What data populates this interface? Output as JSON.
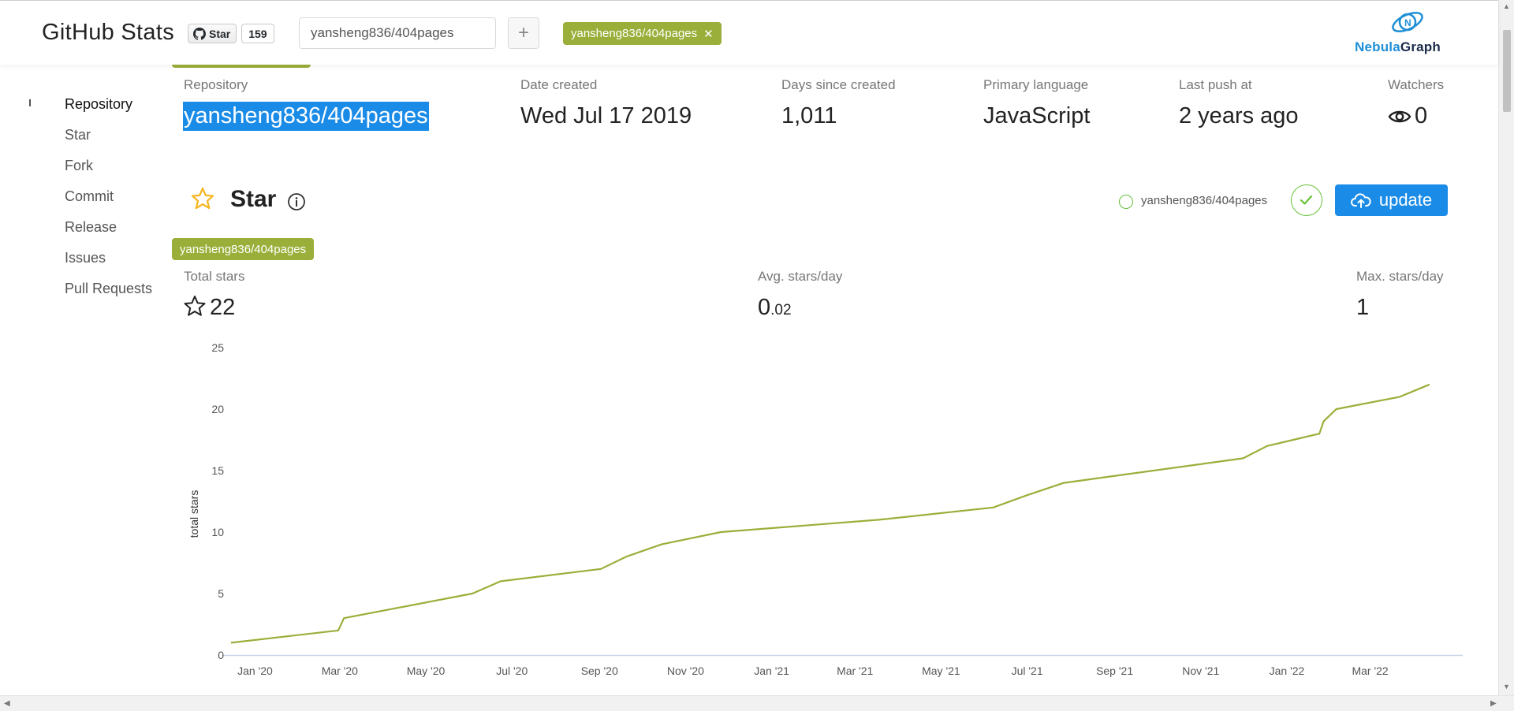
{
  "header": {
    "title": "GitHub Stats",
    "github_star": {
      "label": "Star",
      "count": "159"
    },
    "repo_input": {
      "value": "yansheng836/404pages"
    },
    "add_button": "+",
    "selected_repo_tag": "yansheng836/404pages",
    "logo": {
      "part1": "Nebula",
      "part2": "Graph"
    }
  },
  "sidebar": {
    "items": [
      {
        "label": "Repository",
        "active": true
      },
      {
        "label": "Star"
      },
      {
        "label": "Fork"
      },
      {
        "label": "Commit"
      },
      {
        "label": "Release"
      },
      {
        "label": "Issues"
      },
      {
        "label": "Pull Requests"
      }
    ]
  },
  "repository": {
    "labels": {
      "repository": "Repository",
      "date_created": "Date created",
      "days_since": "Days since created",
      "language": "Primary language",
      "last_push": "Last push at",
      "watchers": "Watchers"
    },
    "values": {
      "repository": "yansheng836/404pages",
      "date_created": "Wed Jul 17 2019",
      "days_since": "1,011",
      "language": "JavaScript",
      "last_push": "2 years ago",
      "watchers": "0"
    }
  },
  "star_section": {
    "title": "Star",
    "legend_label": "yansheng836/404pages",
    "update_label": "update",
    "repo_tag": "yansheng836/404pages",
    "stats": {
      "total_label": "Total stars",
      "total_value": "22",
      "avg_label": "Avg. stars/day",
      "avg_int": "0",
      "avg_frac": ".02",
      "max_label": "Max. stars/day",
      "max_value": "1"
    }
  },
  "colors": {
    "accent": "#1a8ce8",
    "line": "#9aaf3a",
    "success": "#67c23a",
    "star": "#f5b41b"
  },
  "chart_data": {
    "type": "line",
    "ylabel": "total stars",
    "ylim": [
      0,
      25
    ],
    "yticks": [
      0,
      5,
      10,
      15,
      20,
      25
    ],
    "xlim": [
      "2019-12-15",
      "2022-04-30"
    ],
    "xticks": [
      {
        "date": "2020-01-01",
        "label": "Jan '20"
      },
      {
        "date": "2020-03-01",
        "label": "Mar '20"
      },
      {
        "date": "2020-05-01",
        "label": "May '20"
      },
      {
        "date": "2020-07-01",
        "label": "Jul '20"
      },
      {
        "date": "2020-09-01",
        "label": "Sep '20"
      },
      {
        "date": "2020-11-01",
        "label": "Nov '20"
      },
      {
        "date": "2021-01-01",
        "label": "Jan '21"
      },
      {
        "date": "2021-03-01",
        "label": "Mar '21"
      },
      {
        "date": "2021-05-01",
        "label": "May '21"
      },
      {
        "date": "2021-07-01",
        "label": "Jul '21"
      },
      {
        "date": "2021-09-01",
        "label": "Sep '21"
      },
      {
        "date": "2021-11-01",
        "label": "Nov '21"
      },
      {
        "date": "2022-01-01",
        "label": "Jan '22"
      },
      {
        "date": "2022-03-01",
        "label": "Mar '22"
      }
    ],
    "grid": false,
    "series": [
      {
        "name": "yansheng836/404pages",
        "points": [
          {
            "x": "2019-12-15",
            "y": 1
          },
          {
            "x": "2020-02-29",
            "y": 2
          },
          {
            "x": "2020-03-04",
            "y": 3
          },
          {
            "x": "2020-06-03",
            "y": 5
          },
          {
            "x": "2020-06-23",
            "y": 6
          },
          {
            "x": "2020-09-02",
            "y": 7
          },
          {
            "x": "2020-09-20",
            "y": 8
          },
          {
            "x": "2020-10-15",
            "y": 9
          },
          {
            "x": "2020-11-26",
            "y": 10
          },
          {
            "x": "2021-03-18",
            "y": 11
          },
          {
            "x": "2021-06-07",
            "y": 12
          },
          {
            "x": "2021-07-01",
            "y": 13
          },
          {
            "x": "2021-07-27",
            "y": 14
          },
          {
            "x": "2021-12-01",
            "y": 16
          },
          {
            "x": "2021-12-18",
            "y": 17
          },
          {
            "x": "2022-01-24",
            "y": 18
          },
          {
            "x": "2022-01-27",
            "y": 19
          },
          {
            "x": "2022-02-05",
            "y": 20
          },
          {
            "x": "2022-03-22",
            "y": 21
          },
          {
            "x": "2022-04-12",
            "y": 22
          }
        ]
      }
    ]
  }
}
